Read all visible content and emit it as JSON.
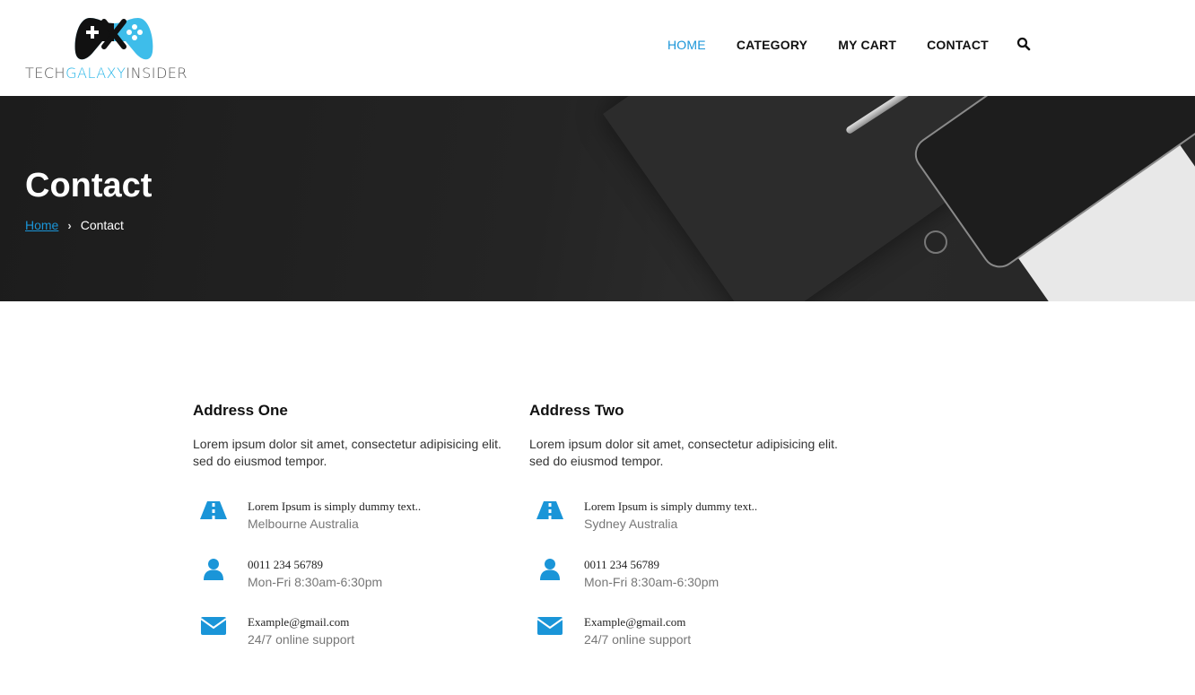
{
  "brand": {
    "logo_part1": "TECH",
    "logo_part2": "GALAXY",
    "logo_part3": "INSIDER",
    "accent_color": "#1a95d8",
    "logo_color": "#29b6e8"
  },
  "nav": {
    "items": [
      {
        "label": "HOME",
        "active": true
      },
      {
        "label": "CATEGORY",
        "active": false
      },
      {
        "label": "MY CART",
        "active": false
      },
      {
        "label": "CONTACT",
        "active": false
      }
    ],
    "search_icon": "search-icon"
  },
  "hero": {
    "title": "Contact",
    "breadcrumb": {
      "home": "Home",
      "separator": "›",
      "current": "Contact"
    }
  },
  "addresses": [
    {
      "heading": "Address One",
      "description": "Lorem ipsum dolor sit amet, consectetur adipisicing elit. sed do eiusmod tempor.",
      "items": [
        {
          "icon": "road-icon",
          "line1": "Lorem Ipsum is simply dummy text..",
          "line2": "Melbourne Australia"
        },
        {
          "icon": "user-icon",
          "line1": "0011 234 56789",
          "line2": "Mon-Fri 8:30am-6:30pm"
        },
        {
          "icon": "envelope-icon",
          "line1": "Example@gmail.com",
          "line2": "24/7 online support"
        }
      ]
    },
    {
      "heading": "Address Two",
      "description": "Lorem ipsum dolor sit amet, consectetur adipisicing elit. sed do eiusmod tempor.",
      "items": [
        {
          "icon": "road-icon",
          "line1": "Lorem Ipsum is simply dummy text..",
          "line2": "Sydney Australia"
        },
        {
          "icon": "user-icon",
          "line1": "0011 234 56789",
          "line2": "Mon-Fri 8:30am-6:30pm"
        },
        {
          "icon": "envelope-icon",
          "line1": "Example@gmail.com",
          "line2": "24/7 online support"
        }
      ]
    }
  ]
}
